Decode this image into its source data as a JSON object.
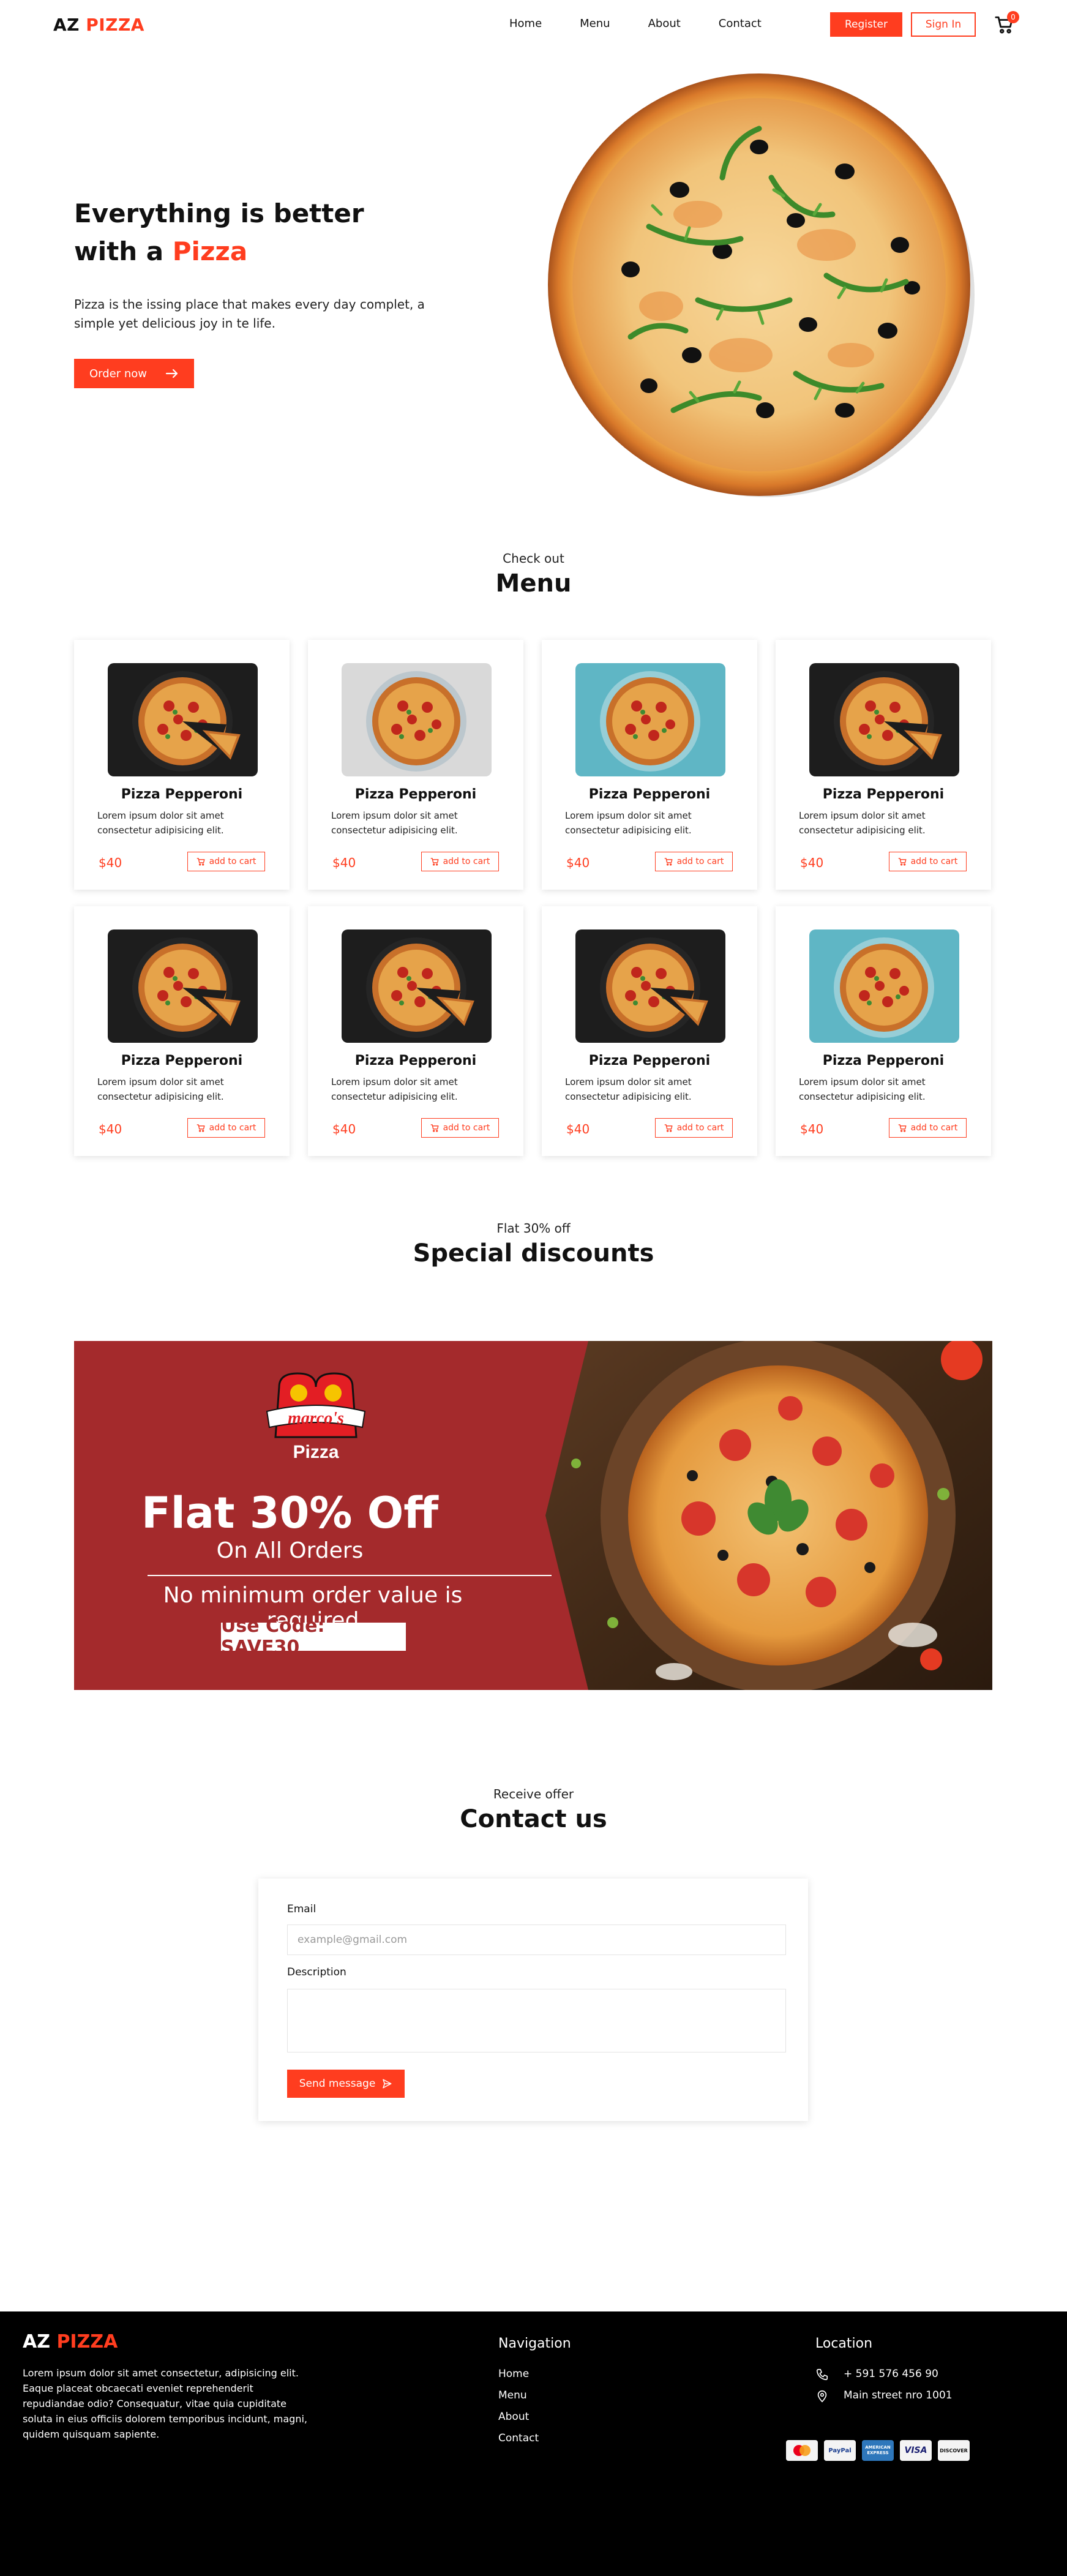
{
  "nav": {
    "logo_main": "AZ",
    "logo_accent": "PIZZA",
    "links": [
      "Home",
      "Menu",
      "About",
      "Contact"
    ],
    "register_label": "Register",
    "signin_label": "Sign In",
    "cart_count": "0"
  },
  "hero": {
    "title_line1": "Everything is better",
    "title_line2_prefix": "with a",
    "title_line2_accent": "Pizza",
    "text": "Pizza is the issing place that makes every day complet, a simple yet delicious joy in te life.",
    "order_label": "Order now"
  },
  "menu": {
    "subtitle": "Check  out",
    "title": "Menu",
    "items": [
      {
        "name": "Pizza Pepperoni",
        "desc": "Lorem ipsum dolor sit amet consectetur adipisicing elit.",
        "price": "$40",
        "btn": "add to cart"
      },
      {
        "name": "Pizza Pepperoni",
        "desc": "Lorem ipsum dolor sit amet consectetur adipisicing elit.",
        "price": "$40",
        "btn": "add to cart"
      },
      {
        "name": "Pizza Pepperoni",
        "desc": "Lorem ipsum dolor sit amet consectetur adipisicing elit.",
        "price": "$40",
        "btn": "add to cart"
      },
      {
        "name": "Pizza Pepperoni",
        "desc": "Lorem ipsum dolor sit amet consectetur adipisicing elit.",
        "price": "$40",
        "btn": "add to cart"
      },
      {
        "name": "Pizza Pepperoni",
        "desc": "Lorem ipsum dolor sit amet consectetur adipisicing elit.",
        "price": "$40",
        "btn": "add to cart"
      },
      {
        "name": "Pizza Pepperoni",
        "desc": "Lorem ipsum dolor sit amet consectetur adipisicing elit.",
        "price": "$40",
        "btn": "add to cart"
      },
      {
        "name": "Pizza Pepperoni",
        "desc": "Lorem ipsum dolor sit amet consectetur adipisicing elit.",
        "price": "$40",
        "btn": "add to cart"
      },
      {
        "name": "Pizza Pepperoni",
        "desc": "Lorem ipsum dolor sit amet consectetur adipisicing elit.",
        "price": "$40",
        "btn": "add to cart"
      }
    ]
  },
  "discounts": {
    "subtitle": "Flat 30% off",
    "title": "Special discounts",
    "banner": {
      "brand": "marco's",
      "brand_sub": "Pizza",
      "headline": "Flat 30% Off",
      "subline": "On All Orders",
      "condition": "No minimum order value is required",
      "code": "Use Code: SAVE30"
    }
  },
  "contact": {
    "subtitle": "Receive  offer",
    "title": "Contact us",
    "email_label": "Email",
    "email_placeholder": "example@gmail.com",
    "description_label": "Description",
    "send_label": "Send message"
  },
  "footer": {
    "logo_main": "AZ",
    "logo_accent": "PIZZA",
    "description": "Lorem ipsum dolor sit amet consectetur, adipisicing elit. Eaque placeat obcaecati eveniet reprehenderit repudiandae odio? Consequatur, vitae quia cupiditate soluta in eius officiis dolorem temporibus incidunt, magni, quidem quisquam sapiente.",
    "nav_heading": "Navigation",
    "nav_links": [
      "Home",
      "Menu",
      "About",
      "Contact"
    ],
    "location_heading": "Location",
    "phone": "+ 591 576 456 90",
    "address": "Main street nro 1001",
    "payments": [
      "MasterCard",
      "PayPal",
      "AMERICAN EXPRESS",
      "VISA",
      "DISCOVER"
    ]
  },
  "colors": {
    "accent": "#ff3d1f",
    "banner_red": "#a42a2c",
    "footer_bg": "#000000"
  }
}
